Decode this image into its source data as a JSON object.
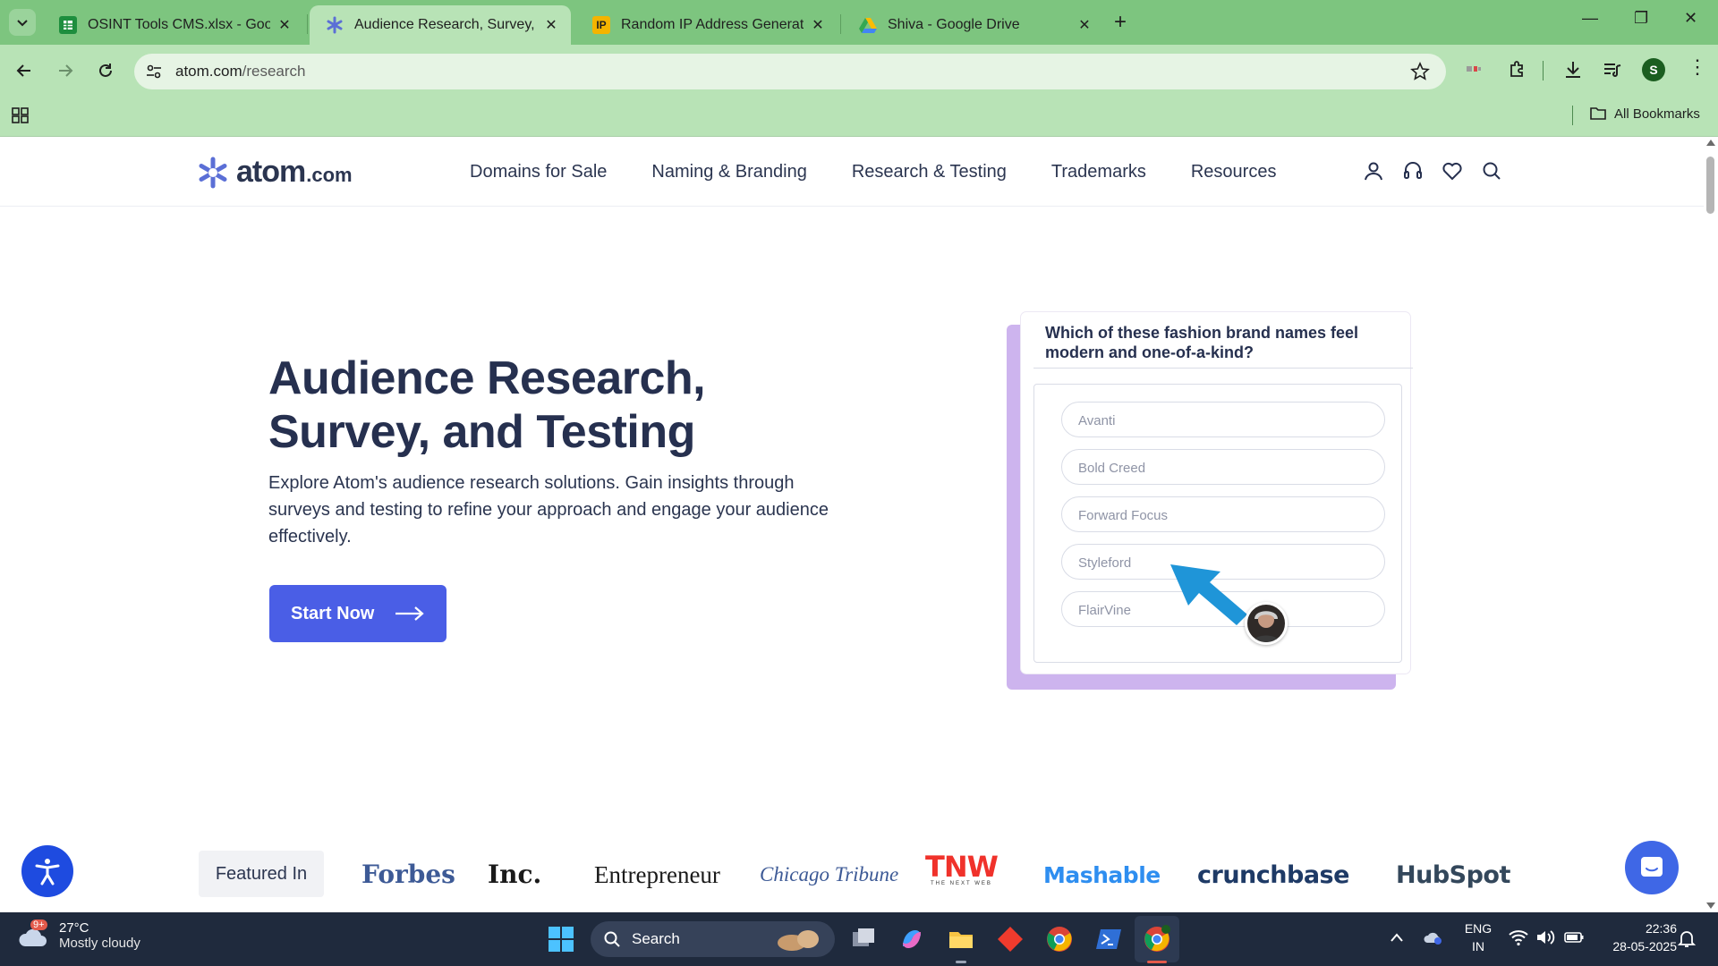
{
  "browser": {
    "tabs": [
      {
        "title": "OSINT Tools CMS.xlsx - Google",
        "favicon": "sheets-icon"
      },
      {
        "title": "Audience Research, Survey, and",
        "favicon": "atom-icon",
        "active": true
      },
      {
        "title": "Random IP Address Generator,",
        "favicon": "ip-icon",
        "favicon_text": "IP"
      },
      {
        "title": "Shiva - Google Drive",
        "favicon": "drive-icon"
      }
    ],
    "url_host": "atom.com",
    "url_path": "/research",
    "profile_initial": "S",
    "all_bookmarks": "All Bookmarks"
  },
  "site": {
    "logo_word": "atom",
    "logo_tld": ".com",
    "nav": [
      "Domains for Sale",
      "Naming & Branding",
      "Research & Testing",
      "Trademarks",
      "Resources"
    ]
  },
  "hero": {
    "title": "Audience Research, Survey, and Testing",
    "description": "Explore Atom's audience research solutions. Gain insights through surveys and testing to refine your approach and engage your audience effectively.",
    "cta_label": "Start Now"
  },
  "survey": {
    "question": "Which of these fashion brand names feel modern and one-of-a-kind?",
    "options": [
      "Avanti",
      "Bold Creed",
      "Forward Focus",
      "Styleford",
      "FlairVine"
    ]
  },
  "featured": {
    "label": "Featured In",
    "brands": [
      "Forbes",
      "Inc.",
      "Entrepreneur",
      "Chicago Tribune",
      "TNW",
      "THE NEXT WEB",
      "Mashable",
      "crunchbase",
      "HubSpot"
    ]
  },
  "taskbar": {
    "temperature": "27°C",
    "condition": "Mostly cloudy",
    "weather_badge": "9+",
    "search_label": "Search",
    "lang_line1": "ENG",
    "lang_line2": "IN",
    "time": "22:36",
    "date": "28-05-2025"
  },
  "colors": {
    "chrome_green": "#7dc57f",
    "toolbar_green": "#b8e3b6",
    "brand_navy": "#26304f",
    "cta_blue": "#4a5ee6",
    "cursor_blue": "#1f95d8",
    "card_shadow": "#cdb4ee"
  }
}
